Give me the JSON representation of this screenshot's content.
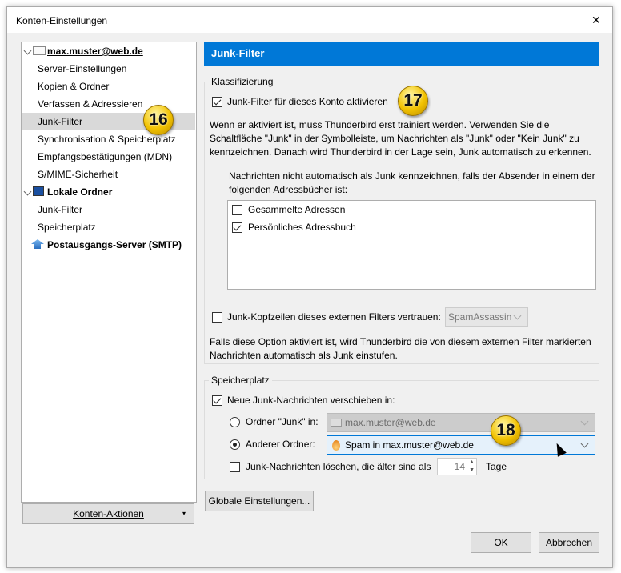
{
  "window": {
    "title": "Konten-Einstellungen",
    "close": "✕"
  },
  "sidebar": {
    "items": [
      {
        "label": "max.muster@web.de",
        "type": "account"
      },
      {
        "label": "Server-Einstellungen"
      },
      {
        "label": "Kopien & Ordner"
      },
      {
        "label": "Verfassen & Adressieren"
      },
      {
        "label": "Junk-Filter",
        "selected": true
      },
      {
        "label": "Synchronisation & Speicherplatz"
      },
      {
        "label": "Empfangsbestätigungen (MDN)"
      },
      {
        "label": "S/MIME-Sicherheit"
      },
      {
        "label": "Lokale Ordner",
        "type": "account"
      },
      {
        "label": "Junk-Filter"
      },
      {
        "label": "Speicherplatz"
      },
      {
        "label": "Postausgangs-Server (SMTP)",
        "type": "account"
      }
    ],
    "actions_button": "Konten-Aktionen"
  },
  "badges": [
    "16",
    "17",
    "18"
  ],
  "main": {
    "header": "Junk-Filter",
    "classification": {
      "legend": "Klassifizierung",
      "enable_label": "Junk-Filter für dieses Konto aktivieren",
      "enable_checked": true,
      "description": "Wenn er aktiviert ist, muss Thunderbird erst trainiert werden. Verwenden Sie die Schaltfläche \"Junk\" in der Symbolleiste, um Nachrichten als \"Junk\" oder \"Kein Junk\" zu kennzeichnen. Danach wird Thunderbird in der Lage sein, Junk automatisch zu erkennen.",
      "whitelist_label": "Nachrichten nicht automatisch als Junk kennzeichnen, falls der Absender in einem der folgenden Adressbücher ist:",
      "addressbooks": [
        {
          "label": "Gesammelte Adressen",
          "checked": false
        },
        {
          "label": "Persönliches Adressbuch",
          "checked": true
        }
      ],
      "trust_headers_label": "Junk-Kopfzeilen dieses externen Filters vertrauen:",
      "trust_headers_checked": false,
      "trust_headers_select": "SpamAssassin",
      "trust_headers_desc": "Falls diese Option aktiviert ist, wird Thunderbird die von diesem externen Filter markierten Nachrichten automatisch als Junk einstufen."
    },
    "storage": {
      "legend": "Speicherplatz",
      "move_label": "Neue Junk-Nachrichten verschieben in:",
      "move_checked": true,
      "junk_folder_label": "Ordner \"Junk\" in:",
      "junk_folder_value": "max.muster@web.de",
      "other_folder_label": "Anderer Ordner:",
      "other_folder_value": "Spam in max.muster@web.de",
      "selected_radio": "other",
      "delete_label": "Junk-Nachrichten löschen, die älter sind als",
      "delete_checked": false,
      "delete_days": "14",
      "days_unit": "Tage"
    },
    "global_button": "Globale Einstellungen..."
  },
  "footer": {
    "ok": "OK",
    "cancel": "Abbrechen"
  },
  "colors": {
    "accent": "#0078d7",
    "selected_row": "#d9d9d9"
  }
}
